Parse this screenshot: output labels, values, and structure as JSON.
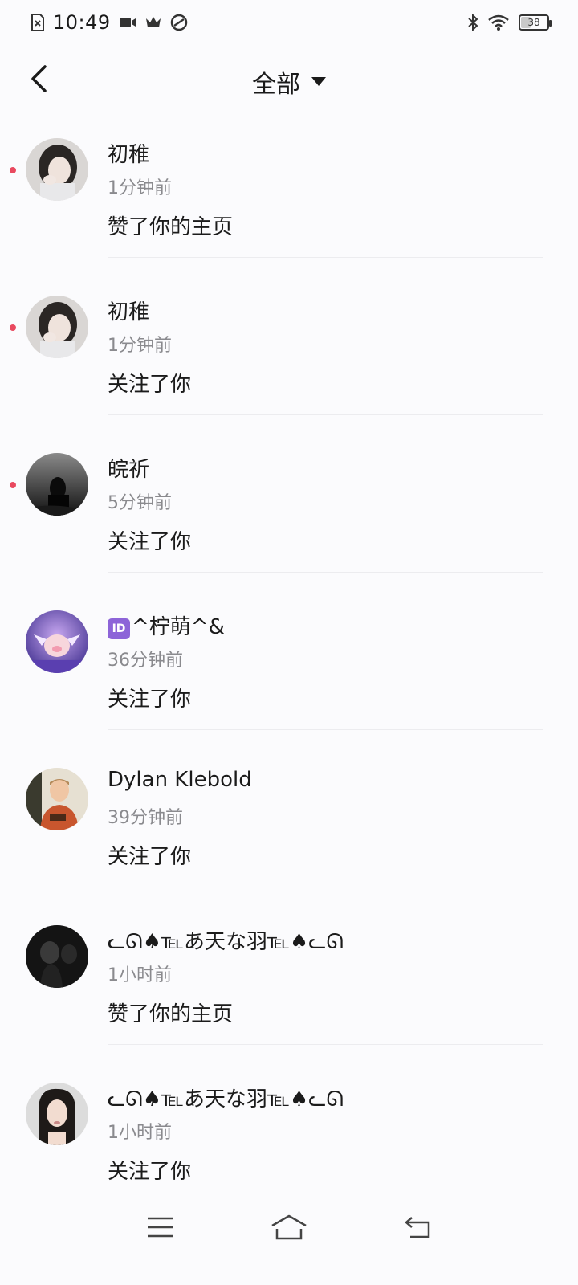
{
  "status_bar": {
    "time": "10:49",
    "battery": "38",
    "battery_level": 0.38,
    "icons": [
      "sim-off-icon",
      "video-icon",
      "crown-icon",
      "app-icon",
      "bluetooth-icon",
      "wifi-icon",
      "battery-icon"
    ]
  },
  "header": {
    "back_icon": "chevron-left-icon",
    "filter_label": "全部",
    "filter_icon": "caret-down-icon"
  },
  "colors": {
    "unread_dot": "#e9495f",
    "id_badge": "#8d64d8",
    "secondary_text": "#8a8a8e"
  },
  "notifications": [
    {
      "username": "初稚",
      "time": "1分钟前",
      "action": "赞了你的主页",
      "unread": true,
      "avatar": "avatar-girl-1"
    },
    {
      "username": "初稚",
      "time": "1分钟前",
      "action": "关注了你",
      "unread": true,
      "avatar": "avatar-girl-1"
    },
    {
      "username": "皖祈",
      "time": "5分钟前",
      "action": "关注了你",
      "unread": true,
      "avatar": "avatar-dark-figure"
    },
    {
      "username_badge": "ID",
      "username": "^柠萌^&",
      "time": "36分钟前",
      "action": "关注了你",
      "unread": false,
      "avatar": "avatar-purple-character"
    },
    {
      "username": "Dylan  Klebold",
      "time": "39分钟前",
      "action": "关注了你",
      "unread": false,
      "avatar": "avatar-man"
    },
    {
      "username": "ᓚᘏ♠℡あ天な羽℡♠ᓚᘏ",
      "time": "1小时前",
      "action": "赞了你的主页",
      "unread": false,
      "avatar": "avatar-silhouette"
    },
    {
      "username": "ᓚᘏ♠℡あ天な羽℡♠ᓚᘏ",
      "time": "1小时前",
      "action": "关注了你",
      "unread": false,
      "avatar": "avatar-woman"
    }
  ],
  "nav_bar": {
    "icons": [
      "menu-icon",
      "home-icon",
      "back-icon"
    ]
  }
}
